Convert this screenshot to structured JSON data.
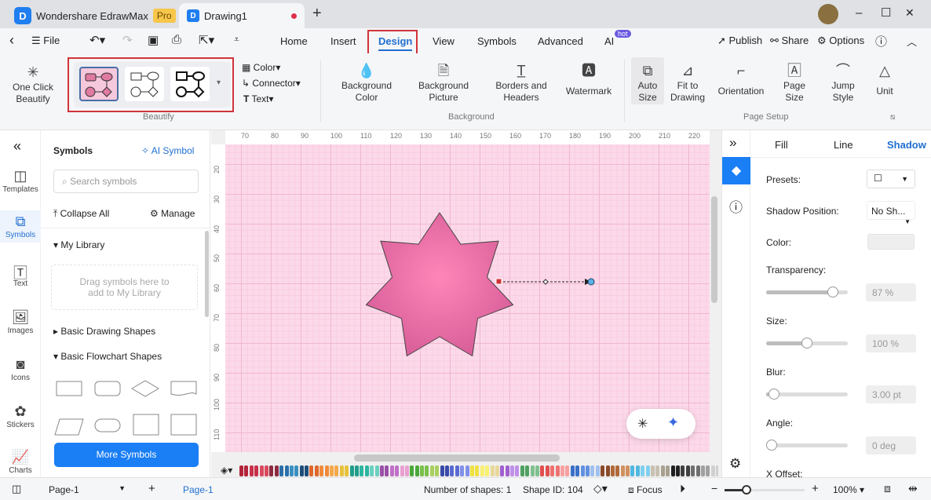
{
  "app": {
    "title": "Wondershare EdrawMax",
    "badge": "Pro",
    "doc_tab": "Drawing1",
    "new_tab": "+"
  },
  "window": {
    "minimize": "–",
    "maximize": "☐",
    "close": "✕"
  },
  "menubar": {
    "back": "‹",
    "file": "File",
    "tabs": [
      "Home",
      "Insert",
      "Design",
      "View",
      "Symbols",
      "Advanced",
      "AI"
    ],
    "active_tab": "Design",
    "ai_badge": "hot",
    "publish": "Publish",
    "share": "Share",
    "options": "Options"
  },
  "ribbon": {
    "one_click_beautify": "One Click Beautify",
    "beautify_group": "Beautify",
    "color": "Color",
    "connector": "Connector",
    "text": "Text",
    "background_color": "Background Color",
    "background_picture": "Background Picture",
    "borders_headers": "Borders and Headers",
    "watermark": "Watermark",
    "background_group": "Background",
    "auto_size": "Auto Size",
    "fit_to_drawing": "Fit to Drawing",
    "orientation": "Orientation",
    "page_size": "Page Size",
    "jump_style": "Jump Style",
    "unit": "Unit",
    "page_setup_group": "Page Setup"
  },
  "rail": [
    "Templates",
    "Symbols",
    "Text",
    "Images",
    "Icons",
    "Stickers",
    "Charts"
  ],
  "symbols": {
    "title": "Symbols",
    "ai_symbol": "AI Symbol",
    "search_placeholder": "Search symbols",
    "collapse_all": "Collapse All",
    "manage": "Manage",
    "my_library": "My Library",
    "drop_hint": "Drag symbols here to add to My Library",
    "basic_drawing": "Basic Drawing Shapes",
    "basic_flowchart": "Basic Flowchart Shapes",
    "more_symbols": "More Symbols"
  },
  "ruler": {
    "top": [
      "70",
      "80",
      "90",
      "100",
      "110",
      "120",
      "130",
      "140",
      "150",
      "160",
      "170",
      "180",
      "190",
      "200",
      "210",
      "220"
    ],
    "left": [
      "20",
      "30",
      "40",
      "50",
      "60",
      "70",
      "80",
      "90",
      "100",
      "110"
    ]
  },
  "canvas": {
    "page_color": "#fcd9ea",
    "shape_fill": "#f083b5"
  },
  "panel": {
    "tabs": [
      "Fill",
      "Line",
      "Shadow"
    ],
    "active_tab": "Shadow",
    "presets": "Presets:",
    "shadow_position": "Shadow Position:",
    "shadow_position_value": "No Sh...",
    "color": "Color:",
    "transparency": "Transparency:",
    "transparency_value": "87 %",
    "transparency_level": 87,
    "size": "Size:",
    "size_value": "100 %",
    "size_level": 50,
    "blur": "Blur:",
    "blur_value": "3.00 pt",
    "blur_level": 3,
    "angle": "Angle:",
    "angle_value": "0 deg",
    "angle_level": 0,
    "x_offset": "X Offset:"
  },
  "statusbar": {
    "page_select": "Page-1",
    "page_tab": "Page-1",
    "shapes": "Number of shapes: 1",
    "shape_id": "Shape ID: 104",
    "focus": "Focus",
    "zoom": "100%"
  },
  "palette": [
    "#b3243a",
    "#c8304a",
    "#d94a5e",
    "#8c2a3f",
    "#2a6fa8",
    "#3a8fc0",
    "#1d4e7a",
    "#e0672a",
    "#f08a3a",
    "#f5a94a",
    "#e8c23a",
    "#1f9d8a",
    "#2cb5a0",
    "#6ad0c0",
    "#9a4fa8",
    "#c070c8",
    "#e8a0d0",
    "#4aa83a",
    "#7ac04a",
    "#a8d060",
    "#3a4aa8",
    "#5a6ad0",
    "#8090e8",
    "#f0e040",
    "#f8f070",
    "#e8d89a",
    "#a060d0",
    "#c090e8",
    "#50a060",
    "#80c090",
    "#e05050",
    "#f07070",
    "#f8a0a0",
    "#3a70c8",
    "#6090e0",
    "#a0c0f0",
    "#8a4a2a",
    "#b06a3a",
    "#d09060",
    "#50b8e0",
    "#80d0f0",
    "#c8c0b0",
    "#a8a090",
    "#202020",
    "#404040",
    "#707070",
    "#a0a0a0",
    "#d0d0d0",
    "#e8e8e8"
  ]
}
